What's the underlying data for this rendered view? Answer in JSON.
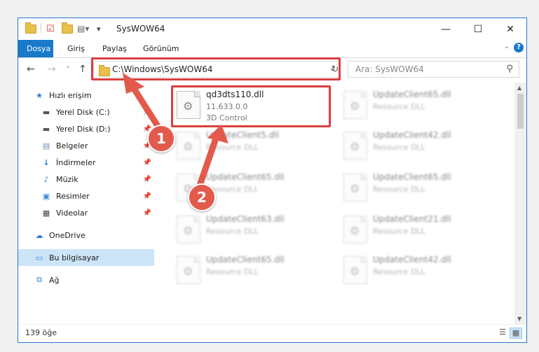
{
  "window": {
    "title": "SysWOW64",
    "controls": {
      "minimize": "—",
      "maximize": "☐",
      "close": "✕"
    }
  },
  "ribbon": {
    "tabs": [
      "Dosya",
      "Giriş",
      "Paylaş",
      "Görünüm"
    ],
    "help": "?"
  },
  "navigation": {
    "back": "←",
    "forward": "→",
    "recent": "˅",
    "up": "↑",
    "address": "C:\\Windows\\SysWOW64",
    "search_placeholder": "Ara: SysWOW64"
  },
  "sidebar": {
    "items": [
      {
        "label": "Hızlı erişim",
        "icon": "star-icon"
      },
      {
        "label": "Yerel Disk (C:)",
        "icon": "drive-icon",
        "pinned": true
      },
      {
        "label": "Yerel Disk (D:)",
        "icon": "drive-icon",
        "pinned": true
      },
      {
        "label": "Belgeler",
        "icon": "documents-icon",
        "pinned": true
      },
      {
        "label": "İndirmeler",
        "icon": "downloads-icon",
        "pinned": true
      },
      {
        "label": "Müzik",
        "icon": "music-icon",
        "pinned": true
      },
      {
        "label": "Resimler",
        "icon": "pictures-icon",
        "pinned": true
      },
      {
        "label": "Videolar",
        "icon": "videos-icon",
        "pinned": true
      },
      {
        "label": "OneDrive",
        "icon": "cloud-icon"
      },
      {
        "label": "Bu bilgisayar",
        "icon": "computer-icon",
        "selected": true
      },
      {
        "label": "Ağ",
        "icon": "network-icon"
      }
    ]
  },
  "files": [
    {
      "name": "qd3dts110.dll",
      "version": "11.633.0.0",
      "description": "3D Control",
      "highlighted": true
    },
    {
      "name": "UpdateClient65.dll",
      "description": "Resource DLL"
    },
    {
      "name": "UpdateClient5.dll",
      "description": "Resource DLL"
    },
    {
      "name": "UpdateClient42.dll",
      "description": "Resource DLL"
    },
    {
      "name": "UpdateClient65.dll",
      "description": "Resource DLL"
    },
    {
      "name": "UpdateClient65.dll",
      "description": "Resource DLL"
    },
    {
      "name": "UpdateClient63.dll",
      "description": "Resource DLL"
    },
    {
      "name": "UpdateClient21.dll",
      "description": "Resource DLL"
    },
    {
      "name": "UpdateClient65.dll",
      "description": "Resource DLL"
    },
    {
      "name": "UpdateClient42.dll",
      "description": "Resource DLL"
    }
  ],
  "status": {
    "item_count": "139 öğe"
  },
  "annotations": [
    "1",
    "2"
  ],
  "colors": {
    "accent": "#1979ca",
    "highlight": "#d94040",
    "marker": "#e25a4c",
    "selection": "#cce4f7"
  }
}
